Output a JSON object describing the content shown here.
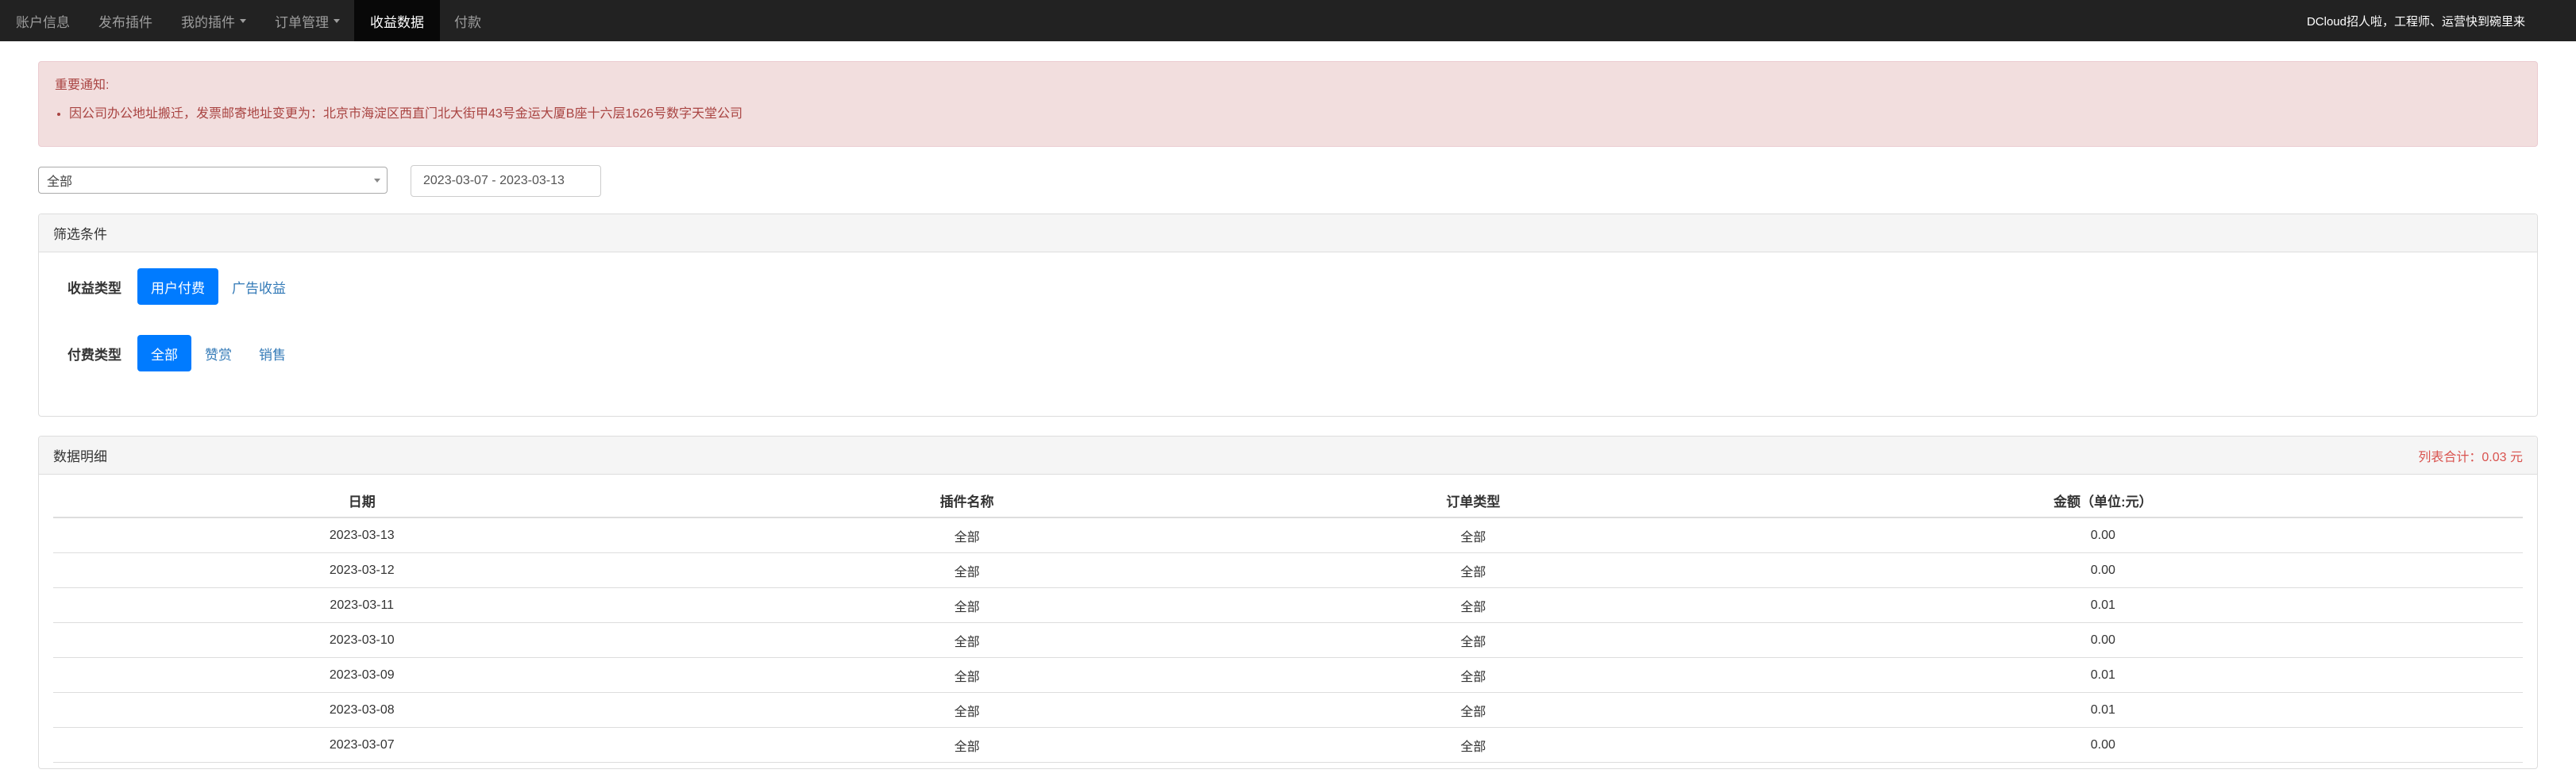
{
  "nav": {
    "items": [
      {
        "label": "账户信息",
        "dropdown": false,
        "active": false
      },
      {
        "label": "发布插件",
        "dropdown": false,
        "active": false
      },
      {
        "label": "我的插件",
        "dropdown": true,
        "active": false
      },
      {
        "label": "订单管理",
        "dropdown": true,
        "active": false
      },
      {
        "label": "收益数据",
        "dropdown": false,
        "active": true
      },
      {
        "label": "付款",
        "dropdown": false,
        "active": false
      }
    ],
    "right_link": "DCloud招人啦，工程师、运营快到碗里来"
  },
  "alert": {
    "title": "重要通知:",
    "items": [
      "因公司办公地址搬迁，发票邮寄地址变更为：北京市海淀区西直门北大街甲43号金运大厦B座十六层1626号数字天堂公司"
    ],
    "color": "#a94442",
    "background": "#f2dede"
  },
  "filters": {
    "select_value": "全部",
    "date_range": "2023-03-07 - 2023-03-13"
  },
  "filter_panel": {
    "title": "筛选条件",
    "income_type": {
      "label": "收益类型",
      "options": [
        {
          "label": "用户付费",
          "active": true
        },
        {
          "label": "广告收益",
          "active": false
        }
      ]
    },
    "pay_type": {
      "label": "付费类型",
      "options": [
        {
          "label": "全部",
          "active": true
        },
        {
          "label": "赞赏",
          "active": false
        },
        {
          "label": "销售",
          "active": false
        }
      ]
    }
  },
  "data_panel": {
    "title": "数据明细",
    "total": "列表合计：0.03 元",
    "columns": [
      "日期",
      "插件名称",
      "订单类型",
      "金额（单位:元）"
    ],
    "rows": [
      [
        "2023-03-13",
        "全部",
        "全部",
        "0.00"
      ],
      [
        "2023-03-12",
        "全部",
        "全部",
        "0.00"
      ],
      [
        "2023-03-11",
        "全部",
        "全部",
        "0.01"
      ],
      [
        "2023-03-10",
        "全部",
        "全部",
        "0.00"
      ],
      [
        "2023-03-09",
        "全部",
        "全部",
        "0.01"
      ],
      [
        "2023-03-08",
        "全部",
        "全部",
        "0.01"
      ],
      [
        "2023-03-07",
        "全部",
        "全部",
        "0.00"
      ]
    ]
  },
  "colors": {
    "navbar": "#222222",
    "primary": "#007bff",
    "link": "#337ab7",
    "danger": "#d9534f"
  }
}
